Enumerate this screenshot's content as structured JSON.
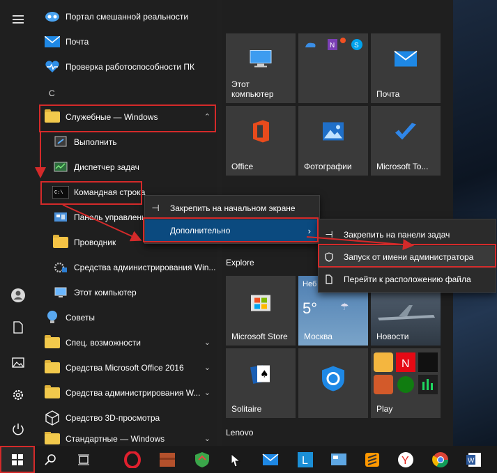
{
  "app_list": {
    "items": [
      {
        "label": "Портал смешанной реальности"
      },
      {
        "label": "Почта"
      },
      {
        "label": "Проверка работоспособности ПК"
      }
    ],
    "letter_c": "С",
    "folder_windows": "Служебные — Windows",
    "sub_items": [
      {
        "label": "Выполнить"
      },
      {
        "label": "Диспетчер задач"
      },
      {
        "label": "Командная строка"
      },
      {
        "label": "Панель управления"
      },
      {
        "label": "Проводник"
      },
      {
        "label": "Средства администрирования Win..."
      },
      {
        "label": "Этот компьютер"
      }
    ],
    "after_items": [
      {
        "label": "Советы"
      },
      {
        "label": "Спец. возможности"
      },
      {
        "label": "Средства Microsoft Office 2016"
      },
      {
        "label": "Средства администрирования W..."
      },
      {
        "label": "Средство 3D-просмотра"
      },
      {
        "label": "Стандартные — Windows"
      }
    ]
  },
  "tiles": {
    "this_pc": "Этот компьютер",
    "mail": "Почта",
    "office": "Office",
    "photos": "Фотографии",
    "todo": "Microsoft To...",
    "group_explore": "Explore",
    "store": "Microsoft Store",
    "weather_city": "Москва",
    "weather_temp": "5°",
    "weather_prefix": "Неб",
    "news": "Новости",
    "solitaire": "Solitaire",
    "play": "Play",
    "group_lenovo": "Lenovo"
  },
  "context_menu_1": {
    "pin_start": "Закрепить на начальном экране",
    "more": "Дополнительно"
  },
  "context_menu_2": {
    "pin_taskbar": "Закрепить на панели задач",
    "run_admin": "Запуск от имени администратора",
    "open_location": "Перейти к расположению файла"
  },
  "colors": {
    "highlight_red": "#d42a2a",
    "accent_blue": "#0b4a7f",
    "folder_yellow": "#f2c94c"
  }
}
